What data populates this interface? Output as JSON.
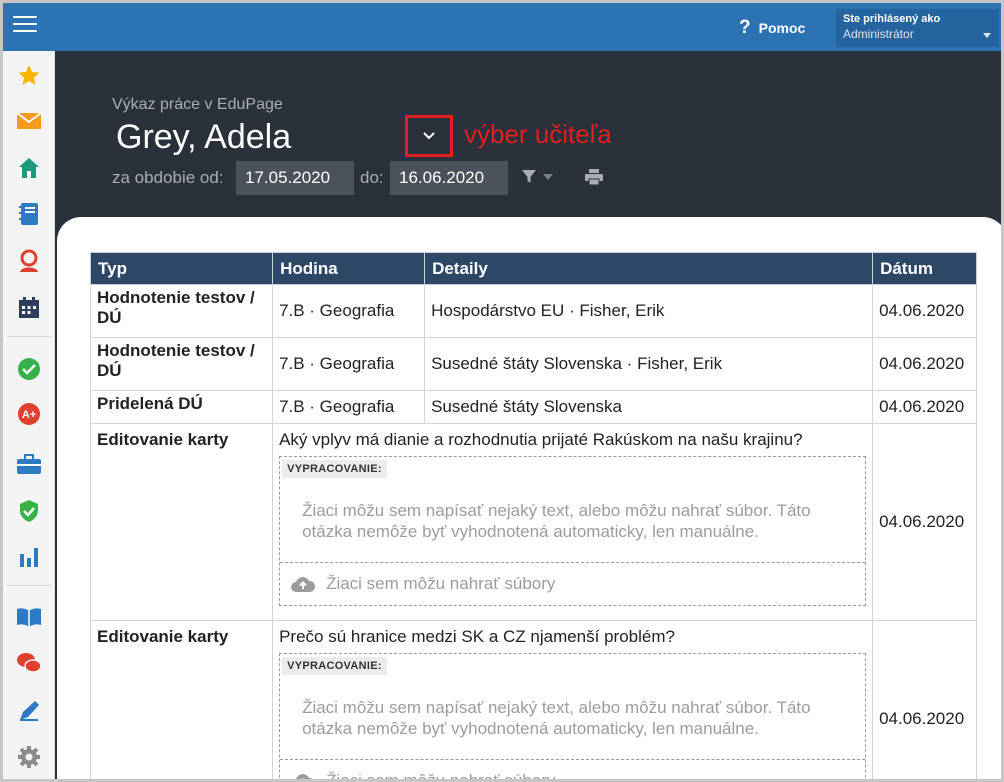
{
  "topbar": {
    "help_label": "Pomoc",
    "user_line1": "Ste prihlásený ako",
    "user_line2": "Administrátor"
  },
  "sidebar": {
    "items": [
      {
        "icon": "star-icon"
      },
      {
        "icon": "mail-icon"
      },
      {
        "icon": "home-icon"
      },
      {
        "icon": "notebook-icon"
      },
      {
        "icon": "user-icon"
      },
      {
        "icon": "calendar-icon"
      },
      {
        "icon": "check-icon"
      },
      {
        "icon": "grade-icon"
      },
      {
        "icon": "briefcase-icon"
      },
      {
        "icon": "shield-icon"
      },
      {
        "icon": "bar-chart-icon"
      },
      {
        "icon": "book-icon"
      },
      {
        "icon": "chat-icon"
      },
      {
        "icon": "pencil-icon"
      },
      {
        "icon": "gear-icon"
      }
    ]
  },
  "header": {
    "subtitle": "Výkaz práce v EduPage",
    "teacher_name": "Grey, Adela",
    "annotation": "výber učiteľa",
    "period_label": "za obdobie od:",
    "date_from": "17.05.2020",
    "to_label": "do:",
    "date_to": "16.06.2020"
  },
  "table": {
    "headers": [
      "Typ",
      "Hodina",
      "Detaily",
      "Dátum"
    ],
    "rows": [
      {
        "typ": "Hodnotenie testov / DÚ",
        "hodina": "7.B · Geografia",
        "detail": "Hospodárstvo EU · Fisher, Erik",
        "datum": "04.06.2020"
      },
      {
        "typ": "Hodnotenie testov / DÚ",
        "hodina": "7.B · Geografia",
        "detail": "Susedné štáty Slovenska · Fisher, Erik",
        "datum": "04.06.2020"
      },
      {
        "typ": "Pridelená DÚ",
        "hodina": "7.B · Geografia",
        "detail": "Susedné štáty Slovenska",
        "datum": "04.06.2020"
      },
      {
        "typ": "Editovanie karty",
        "question": "Aký vplyv má dianie a rozhodnutia prijaté Rakúskom na našu krajinu?",
        "answer_label": "VYPRACOVANIE:",
        "answer_placeholder": "Žiaci môžu sem napísať nejaký text, alebo môžu nahrať súbor. Táto otázka nemôže byť vyhodnotená automaticky, len manuálne.",
        "upload_label": "Žiaci sem môžu nahrať súbory",
        "datum": "04.06.2020"
      },
      {
        "typ": "Editovanie karty",
        "question": "Prečo sú hranice medzi SK a CZ njamenší problém?",
        "answer_label": "VYPRACOVANIE:",
        "answer_placeholder": "Žiaci môžu sem napísať nejaký text, alebo môžu nahrať súbor. Táto otázka nemôže byť vyhodnotená automaticky, len manuálne.",
        "upload_label": "Žiaci sem môžu nahrať súbory",
        "datum": "04.06.2020"
      }
    ]
  }
}
